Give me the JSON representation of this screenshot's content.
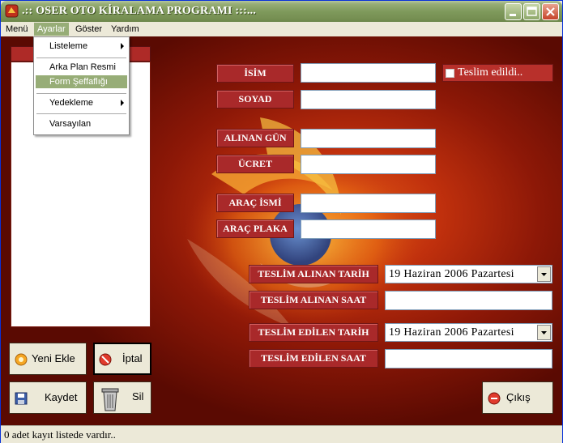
{
  "window": {
    "title": ".:: OSER OTO KİRALAMA PROGRAMI :::..."
  },
  "menubar": {
    "items": [
      "Menü",
      "Ayarlar",
      "Göster",
      "Yardım"
    ]
  },
  "dropdown": {
    "items": [
      {
        "label": "Listeleme",
        "submenu": true
      },
      {
        "label": "Arka Plan Resmi",
        "submenu": false
      },
      {
        "label": "Form Şeffaflığı",
        "submenu": false,
        "highlighted": true
      },
      {
        "label": "Yedekleme",
        "submenu": true
      },
      {
        "label": "Varsayılan",
        "submenu": false
      }
    ]
  },
  "form": {
    "isim_label": "İSİM",
    "soyad_label": "SOYAD",
    "alinan_gun_label": "ALINAN GÜN",
    "ucret_label": "ÜCRET",
    "arac_ismi_label": "ARAÇ İSMİ",
    "arac_plaka_label": "ARAÇ PLAKA",
    "teslim_alinan_tarih_label": "TESLİM ALINAN TARİH",
    "teslim_alinan_saat_label": "TESLİM ALINAN SAAT",
    "teslim_edilen_tarih_label": "TESLİM EDİLEN TARİH",
    "teslim_edilen_saat_label": "TESLİM EDİLEN SAAT",
    "teslim_edildi_label": "Teslim edildi..",
    "teslim_alinan_tarih_value": "19  Haziran  2006  Pazartesi",
    "teslim_edilen_tarih_value": "19  Haziran  2006  Pazartesi",
    "isim_value": "",
    "soyad_value": "",
    "alinan_gun_value": "",
    "ucret_value": "",
    "arac_ismi_value": "",
    "arac_plaka_value": "",
    "teslim_alinan_saat_value": "",
    "teslim_edilen_saat_value": ""
  },
  "buttons": {
    "yeni_ekle": "Yeni Ekle",
    "iptal": "İptal",
    "kaydet": "Kaydet",
    "sil": "Sil",
    "cikis": "Çıkış"
  },
  "status": {
    "text": "0 adet kayıt listede vardır.."
  },
  "colors": {
    "label_bg": "#a9292a",
    "titlebar": "#7f9a5c",
    "menu_highlight": "#97ad77"
  }
}
